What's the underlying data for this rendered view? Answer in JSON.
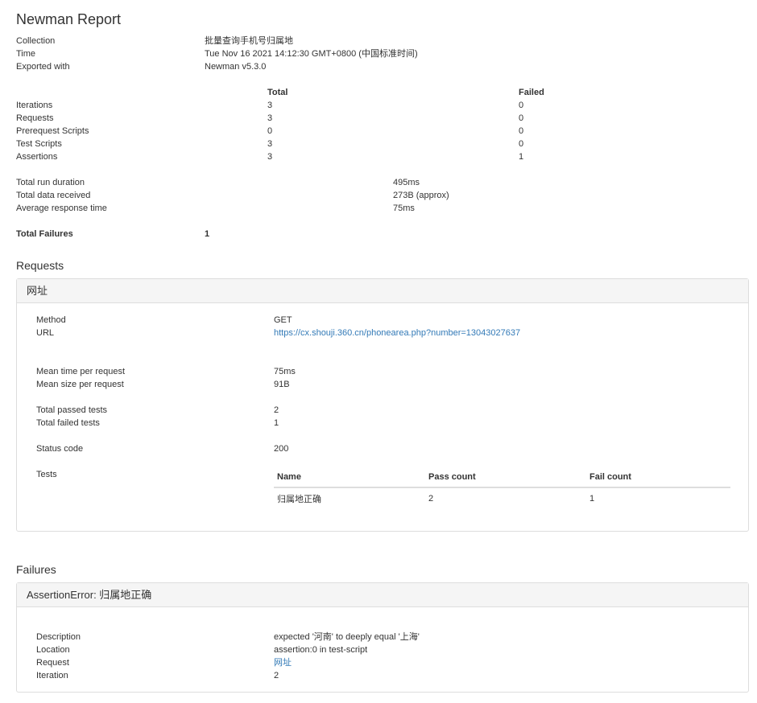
{
  "title": "Newman Report",
  "info": [
    {
      "label": "Collection",
      "value": "批量查询手机号归属地"
    },
    {
      "label": "Time",
      "value": "Tue Nov 16 2021 14:12:30 GMT+0800 (中国标准时间)"
    },
    {
      "label": "Exported with",
      "value": "Newman v5.3.0"
    }
  ],
  "summary": {
    "col_total": "Total",
    "col_failed": "Failed",
    "rows": [
      {
        "label": "Iterations",
        "total": "3",
        "failed": "0"
      },
      {
        "label": "Requests",
        "total": "3",
        "failed": "0"
      },
      {
        "label": "Prerequest Scripts",
        "total": "0",
        "failed": "0"
      },
      {
        "label": "Test Scripts",
        "total": "3",
        "failed": "0"
      },
      {
        "label": "Assertions",
        "total": "3",
        "failed": "1"
      }
    ]
  },
  "timing": [
    {
      "label": "Total run duration",
      "value": "495ms"
    },
    {
      "label": "Total data received",
      "value": "273B (approx)"
    },
    {
      "label": "Average response time",
      "value": "75ms"
    }
  ],
  "total_failures": {
    "label": "Total Failures",
    "value": "1"
  },
  "requests_heading": "Requests",
  "request": {
    "name": "网址",
    "method_label": "Method",
    "method_value": "GET",
    "url_label": "URL",
    "url_value": "https://cx.shouji.360.cn/phonearea.php?number=13043027637",
    "mean_time_label": "Mean time per request",
    "mean_time_value": "75ms",
    "mean_size_label": "Mean size per request",
    "mean_size_value": "91B",
    "passed_label": "Total passed tests",
    "passed_value": "2",
    "failed_label": "Total failed tests",
    "failed_value": "1",
    "status_label": "Status code",
    "status_value": "200",
    "tests_label": "Tests",
    "tests_columns": [
      "Name",
      "Pass count",
      "Fail count"
    ],
    "tests_rows": [
      {
        "name": "归属地正确",
        "pass": "2",
        "fail": "1"
      }
    ]
  },
  "failures_heading": "Failures",
  "failure": {
    "title": "AssertionError: 归属地正确",
    "description_label": "Description",
    "description_value": "expected '河南' to deeply equal '上海'",
    "location_label": "Location",
    "location_value": "assertion:0 in test-script",
    "request_label": "Request",
    "request_value": "网址",
    "iteration_label": "Iteration",
    "iteration_value": "2"
  },
  "colors": {
    "link": "#337ab7",
    "panel_header_bg": "#f5f5f5",
    "border": "#dddddd",
    "text": "#333333"
  }
}
